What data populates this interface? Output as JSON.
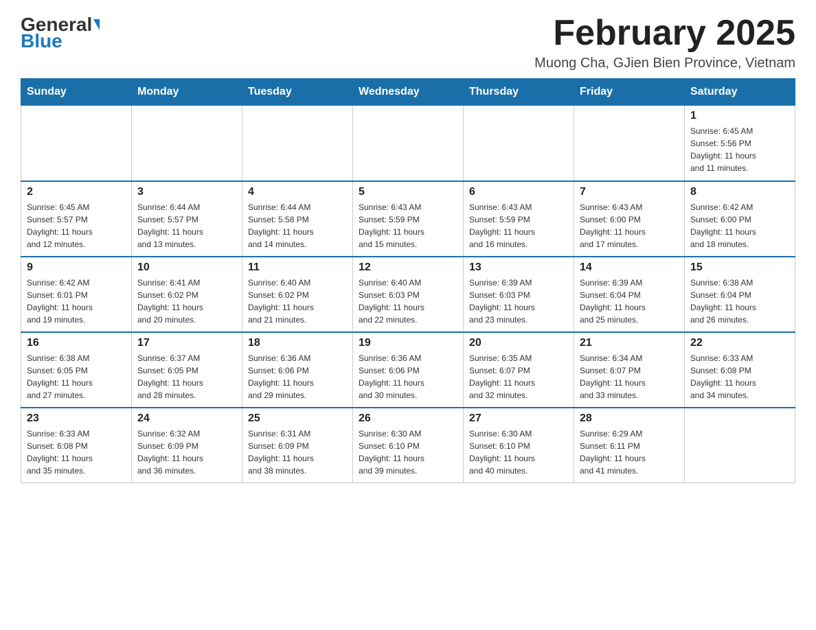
{
  "header": {
    "logo_general": "General",
    "logo_blue": "Blue",
    "month_title": "February 2025",
    "location": "Muong Cha, GJien Bien Province, Vietnam"
  },
  "days_of_week": [
    "Sunday",
    "Monday",
    "Tuesday",
    "Wednesday",
    "Thursday",
    "Friday",
    "Saturday"
  ],
  "weeks": [
    [
      {
        "day": "",
        "info": ""
      },
      {
        "day": "",
        "info": ""
      },
      {
        "day": "",
        "info": ""
      },
      {
        "day": "",
        "info": ""
      },
      {
        "day": "",
        "info": ""
      },
      {
        "day": "",
        "info": ""
      },
      {
        "day": "1",
        "info": "Sunrise: 6:45 AM\nSunset: 5:56 PM\nDaylight: 11 hours\nand 11 minutes."
      }
    ],
    [
      {
        "day": "2",
        "info": "Sunrise: 6:45 AM\nSunset: 5:57 PM\nDaylight: 11 hours\nand 12 minutes."
      },
      {
        "day": "3",
        "info": "Sunrise: 6:44 AM\nSunset: 5:57 PM\nDaylight: 11 hours\nand 13 minutes."
      },
      {
        "day": "4",
        "info": "Sunrise: 6:44 AM\nSunset: 5:58 PM\nDaylight: 11 hours\nand 14 minutes."
      },
      {
        "day": "5",
        "info": "Sunrise: 6:43 AM\nSunset: 5:59 PM\nDaylight: 11 hours\nand 15 minutes."
      },
      {
        "day": "6",
        "info": "Sunrise: 6:43 AM\nSunset: 5:59 PM\nDaylight: 11 hours\nand 16 minutes."
      },
      {
        "day": "7",
        "info": "Sunrise: 6:43 AM\nSunset: 6:00 PM\nDaylight: 11 hours\nand 17 minutes."
      },
      {
        "day": "8",
        "info": "Sunrise: 6:42 AM\nSunset: 6:00 PM\nDaylight: 11 hours\nand 18 minutes."
      }
    ],
    [
      {
        "day": "9",
        "info": "Sunrise: 6:42 AM\nSunset: 6:01 PM\nDaylight: 11 hours\nand 19 minutes."
      },
      {
        "day": "10",
        "info": "Sunrise: 6:41 AM\nSunset: 6:02 PM\nDaylight: 11 hours\nand 20 minutes."
      },
      {
        "day": "11",
        "info": "Sunrise: 6:40 AM\nSunset: 6:02 PM\nDaylight: 11 hours\nand 21 minutes."
      },
      {
        "day": "12",
        "info": "Sunrise: 6:40 AM\nSunset: 6:03 PM\nDaylight: 11 hours\nand 22 minutes."
      },
      {
        "day": "13",
        "info": "Sunrise: 6:39 AM\nSunset: 6:03 PM\nDaylight: 11 hours\nand 23 minutes."
      },
      {
        "day": "14",
        "info": "Sunrise: 6:39 AM\nSunset: 6:04 PM\nDaylight: 11 hours\nand 25 minutes."
      },
      {
        "day": "15",
        "info": "Sunrise: 6:38 AM\nSunset: 6:04 PM\nDaylight: 11 hours\nand 26 minutes."
      }
    ],
    [
      {
        "day": "16",
        "info": "Sunrise: 6:38 AM\nSunset: 6:05 PM\nDaylight: 11 hours\nand 27 minutes."
      },
      {
        "day": "17",
        "info": "Sunrise: 6:37 AM\nSunset: 6:05 PM\nDaylight: 11 hours\nand 28 minutes."
      },
      {
        "day": "18",
        "info": "Sunrise: 6:36 AM\nSunset: 6:06 PM\nDaylight: 11 hours\nand 29 minutes."
      },
      {
        "day": "19",
        "info": "Sunrise: 6:36 AM\nSunset: 6:06 PM\nDaylight: 11 hours\nand 30 minutes."
      },
      {
        "day": "20",
        "info": "Sunrise: 6:35 AM\nSunset: 6:07 PM\nDaylight: 11 hours\nand 32 minutes."
      },
      {
        "day": "21",
        "info": "Sunrise: 6:34 AM\nSunset: 6:07 PM\nDaylight: 11 hours\nand 33 minutes."
      },
      {
        "day": "22",
        "info": "Sunrise: 6:33 AM\nSunset: 6:08 PM\nDaylight: 11 hours\nand 34 minutes."
      }
    ],
    [
      {
        "day": "23",
        "info": "Sunrise: 6:33 AM\nSunset: 6:08 PM\nDaylight: 11 hours\nand 35 minutes."
      },
      {
        "day": "24",
        "info": "Sunrise: 6:32 AM\nSunset: 6:09 PM\nDaylight: 11 hours\nand 36 minutes."
      },
      {
        "day": "25",
        "info": "Sunrise: 6:31 AM\nSunset: 6:09 PM\nDaylight: 11 hours\nand 38 minutes."
      },
      {
        "day": "26",
        "info": "Sunrise: 6:30 AM\nSunset: 6:10 PM\nDaylight: 11 hours\nand 39 minutes."
      },
      {
        "day": "27",
        "info": "Sunrise: 6:30 AM\nSunset: 6:10 PM\nDaylight: 11 hours\nand 40 minutes."
      },
      {
        "day": "28",
        "info": "Sunrise: 6:29 AM\nSunset: 6:11 PM\nDaylight: 11 hours\nand 41 minutes."
      },
      {
        "day": "",
        "info": ""
      }
    ]
  ]
}
